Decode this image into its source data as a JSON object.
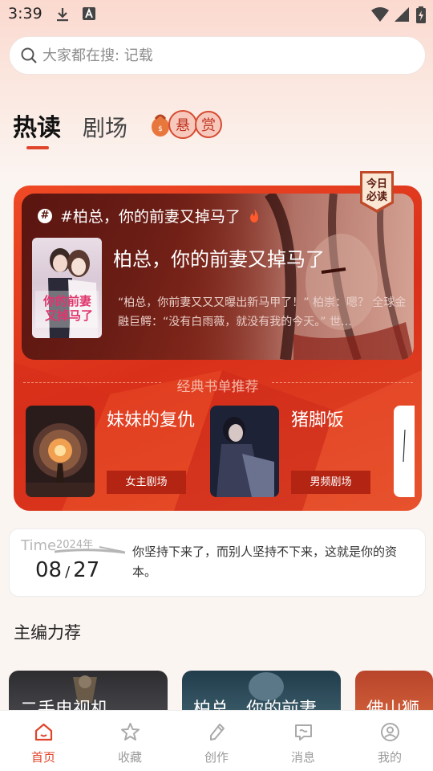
{
  "status_bar": {
    "time": "3:39"
  },
  "search": {
    "placeholder": "大家都在搜: 记载"
  },
  "tabs": [
    {
      "label": "热读",
      "active": true
    },
    {
      "label": "剧场",
      "active": false
    }
  ],
  "reward_tab": {
    "chars": [
      "悬",
      "赏"
    ]
  },
  "featured": {
    "badge": [
      "今日",
      "必读"
    ],
    "topic": "#柏总，你的前妻又掉马了",
    "title": "柏总，你的前妻又掉马了",
    "description": "“柏总，你前妻又又又曝出新马甲了！” 柏崇：嗯？ 全球金融巨鳄：“没有白雨薇，就没有我的今天。” 世…",
    "cover_text": [
      "你的前妻",
      "又掉马了"
    ],
    "section_title": "经典书单推荐",
    "books": [
      {
        "title": "妹妹的复仇",
        "tag": "女主剧场"
      },
      {
        "title": "猪脚饭",
        "tag": "男频剧场"
      }
    ]
  },
  "quote": {
    "time_label": "Time",
    "year": "2024年",
    "month": "08",
    "day": "27",
    "text": "你坚持下来了，而别人坚持不下来，这就是你的资本。"
  },
  "recommend": {
    "title": "主编力荐",
    "cards": [
      "二手电视机",
      "柏总，你的前妻",
      "佛山狮"
    ]
  },
  "nav": [
    {
      "label": "首页",
      "icon": "home-icon",
      "active": true
    },
    {
      "label": "收藏",
      "icon": "star-icon",
      "active": false
    },
    {
      "label": "创作",
      "icon": "pen-icon",
      "active": false
    },
    {
      "label": "消息",
      "icon": "message-icon",
      "active": false
    },
    {
      "label": "我的",
      "icon": "profile-icon",
      "active": false
    }
  ],
  "colors": {
    "accent": "#e0442b",
    "card_red": "#e03a1e",
    "tag_bg": "#b32412"
  }
}
